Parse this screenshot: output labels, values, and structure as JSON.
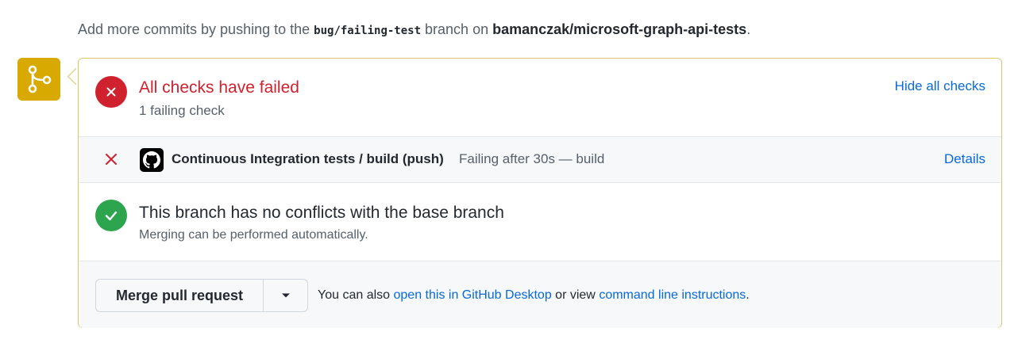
{
  "hint": {
    "prefix": "Add more commits by pushing to the",
    "branch": "bug/failing-test",
    "middle": "branch on",
    "repo": "bamanczak/microsoft-graph-api-tests",
    "suffix": "."
  },
  "checks": {
    "title": "All checks have failed",
    "subtitle": "1 failing check",
    "toggle_label": "Hide all checks",
    "items": [
      {
        "name": "Continuous Integration tests / build (push)",
        "status": "Failing after 30s — build",
        "details_label": "Details"
      }
    ]
  },
  "conflicts": {
    "title": "This branch has no conflicts with the base branch",
    "subtitle": "Merging can be performed automatically."
  },
  "merge": {
    "button_label": "Merge pull request",
    "text_prefix": "You can also",
    "desktop_link": "open this in GitHub Desktop",
    "text_middle": "or view",
    "cli_link": "command line instructions",
    "text_suffix": "."
  },
  "colors": {
    "fail": "#cf222e",
    "success": "#2da44e",
    "link": "#0969da",
    "merge_icon_bg": "#d8a900"
  },
  "icons": {
    "merge_icon": "git-merge-icon",
    "fail_icon": "x-circle-icon",
    "success_icon": "check-circle-icon",
    "row_fail_icon": "x-icon",
    "app_logo": "github-logo-icon",
    "caret": "triangle-down-icon"
  }
}
